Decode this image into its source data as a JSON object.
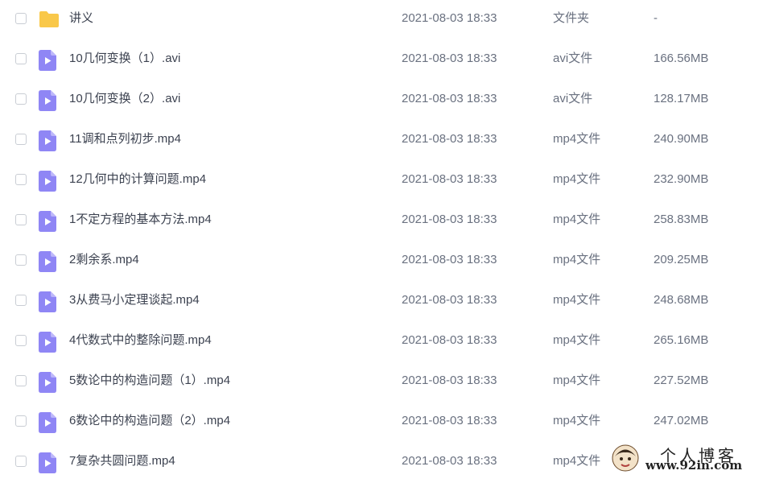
{
  "files": [
    {
      "name": "讲义",
      "date": "2021-08-03 18:33",
      "type": "文件夹",
      "size": "-",
      "icon": "folder-icon"
    },
    {
      "name": "10几何变换（1）.avi",
      "date": "2021-08-03 18:33",
      "type": "avi文件",
      "size": "166.56MB",
      "icon": "video-file-icon"
    },
    {
      "name": "10几何变换（2）.avi",
      "date": "2021-08-03 18:33",
      "type": "avi文件",
      "size": "128.17MB",
      "icon": "video-file-icon"
    },
    {
      "name": "11调和点列初步.mp4",
      "date": "2021-08-03 18:33",
      "type": "mp4文件",
      "size": "240.90MB",
      "icon": "video-file-icon"
    },
    {
      "name": "12几何中的计算问题.mp4",
      "date": "2021-08-03 18:33",
      "type": "mp4文件",
      "size": "232.90MB",
      "icon": "video-file-icon"
    },
    {
      "name": "1不定方程的基本方法.mp4",
      "date": "2021-08-03 18:33",
      "type": "mp4文件",
      "size": "258.83MB",
      "icon": "video-file-icon"
    },
    {
      "name": "2剩余系.mp4",
      "date": "2021-08-03 18:33",
      "type": "mp4文件",
      "size": "209.25MB",
      "icon": "video-file-icon"
    },
    {
      "name": "3从费马小定理谈起.mp4",
      "date": "2021-08-03 18:33",
      "type": "mp4文件",
      "size": "248.68MB",
      "icon": "video-file-icon"
    },
    {
      "name": "4代数式中的整除问题.mp4",
      "date": "2021-08-03 18:33",
      "type": "mp4文件",
      "size": "265.16MB",
      "icon": "video-file-icon"
    },
    {
      "name": "5数论中的构造问题（1）.mp4",
      "date": "2021-08-03 18:33",
      "type": "mp4文件",
      "size": "227.52MB",
      "icon": "video-file-icon"
    },
    {
      "name": "6数论中的构造问题（2）.mp4",
      "date": "2021-08-03 18:33",
      "type": "mp4文件",
      "size": "247.02MB",
      "icon": "video-file-icon"
    },
    {
      "name": "7复杂共圆问题.mp4",
      "date": "2021-08-03 18:33",
      "type": "mp4文件",
      "size": "",
      "icon": "video-file-icon"
    }
  ],
  "watermark": {
    "title": "个人博客",
    "url": "www.92in.com"
  },
  "colors": {
    "folder": "#f9c84a",
    "video": "#8f86f5",
    "video_fold": "#bdb7fa"
  }
}
